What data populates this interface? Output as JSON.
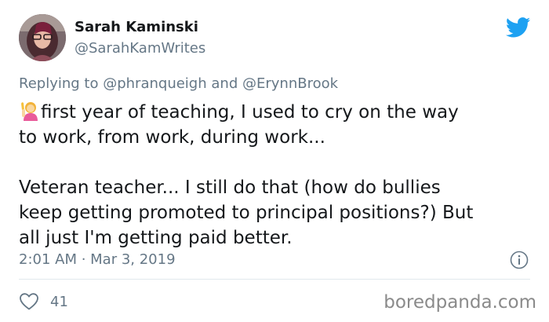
{
  "author": {
    "name": "Sarah Kaminski",
    "handle": "@SarahKamWrites"
  },
  "reply": {
    "prefix": "Replying to",
    "mention_1": "@phranqueigh",
    "conjunction": "and",
    "mention_2": "@ErynnBrook"
  },
  "tweet": {
    "emoji": "woman-raising-hand",
    "line_1": "first year of teaching, I used to cry on the way",
    "line_2": "to work, from work, during work...",
    "line_3": "Veteran teacher... I still do that (how do bullies",
    "line_4": "keep getting promoted to principal positions?) But",
    "line_5": "all just I'm getting paid better."
  },
  "meta": {
    "timestamp": "2:01 AM · Mar 3, 2019"
  },
  "actions": {
    "like_count": "41"
  },
  "watermark": "boredpanda.com",
  "colors": {
    "twitter_blue": "#1da1f2",
    "secondary_text": "#657786",
    "primary_text": "#14171a"
  },
  "icons": {
    "brand": "twitter-bird-icon",
    "info": "info-icon",
    "like": "heart-icon"
  }
}
